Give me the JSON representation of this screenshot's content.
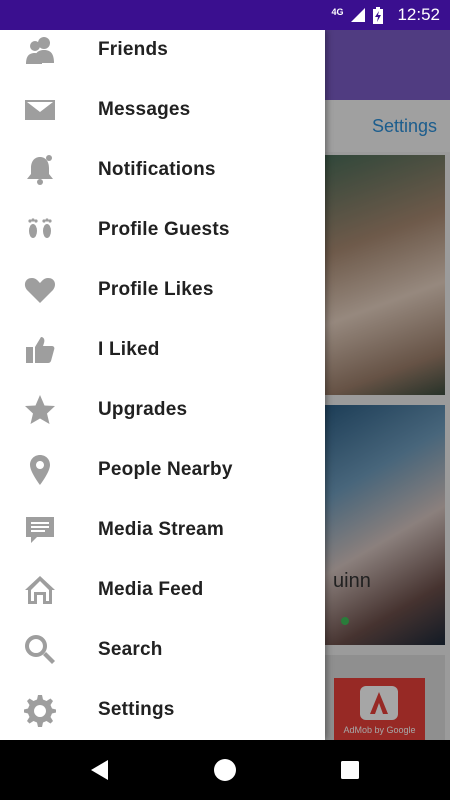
{
  "status_bar": {
    "network": "4G",
    "time": "12:52"
  },
  "background_app": {
    "tab_label": "Settings",
    "card_name_partial": "uinn",
    "ad_text": "AdMob by Google"
  },
  "drawer": {
    "items": [
      {
        "label": "Friends",
        "icon": "friends-icon"
      },
      {
        "label": "Messages",
        "icon": "envelope-icon"
      },
      {
        "label": "Notifications",
        "icon": "bell-icon"
      },
      {
        "label": "Profile Guests",
        "icon": "footprints-icon"
      },
      {
        "label": "Profile Likes",
        "icon": "heart-icon"
      },
      {
        "label": "I Liked",
        "icon": "thumbs-up-icon"
      },
      {
        "label": "Upgrades",
        "icon": "star-icon"
      },
      {
        "label": "People Nearby",
        "icon": "location-pin-icon"
      },
      {
        "label": "Media Stream",
        "icon": "chat-bubble-icon"
      },
      {
        "label": "Media Feed",
        "icon": "home-icon"
      },
      {
        "label": "Search",
        "icon": "search-icon"
      },
      {
        "label": "Settings",
        "icon": "gear-icon"
      }
    ]
  },
  "colors": {
    "status_bar": "#3a0f8f",
    "toolbar": "#7b5cc7",
    "icon_gray": "#9e9e9e",
    "link_blue": "#2b8fd9"
  }
}
